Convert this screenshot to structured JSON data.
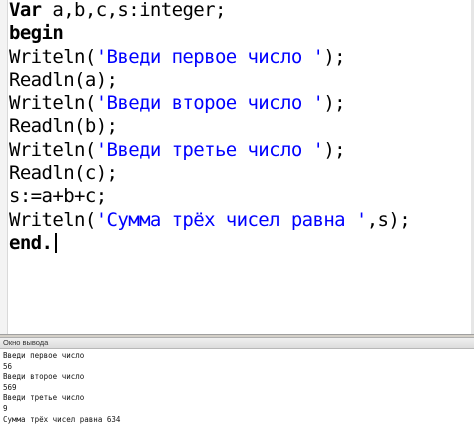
{
  "editor": {
    "lines": [
      {
        "parts": [
          {
            "t": "Var",
            "c": "kw"
          },
          {
            "t": " a,b,c,s:integer;",
            "c": ""
          }
        ]
      },
      {
        "parts": [
          {
            "t": "begin",
            "c": "kw"
          }
        ]
      },
      {
        "parts": [
          {
            "t": "Writeln(",
            "c": ""
          },
          {
            "t": "'Введи первое число '",
            "c": "str"
          },
          {
            "t": ");",
            "c": ""
          }
        ]
      },
      {
        "parts": [
          {
            "t": "Readln(a);",
            "c": ""
          }
        ]
      },
      {
        "parts": [
          {
            "t": "Writeln(",
            "c": ""
          },
          {
            "t": "'Введи второе число '",
            "c": "str"
          },
          {
            "t": ");",
            "c": ""
          }
        ]
      },
      {
        "parts": [
          {
            "t": "Readln(b);",
            "c": ""
          }
        ]
      },
      {
        "parts": [
          {
            "t": "Writeln(",
            "c": ""
          },
          {
            "t": "'Введи третье число '",
            "c": "str"
          },
          {
            "t": ");",
            "c": ""
          }
        ]
      },
      {
        "parts": [
          {
            "t": "Readln(c);",
            "c": ""
          }
        ]
      },
      {
        "parts": [
          {
            "t": "s:=a+b+c;",
            "c": ""
          }
        ]
      },
      {
        "parts": [
          {
            "t": "Writeln(",
            "c": ""
          },
          {
            "t": "'Сумма трёх чисел равна '",
            "c": "str"
          },
          {
            "t": ",s);",
            "c": ""
          }
        ]
      },
      {
        "parts": [
          {
            "t": "end.",
            "c": "kw"
          }
        ],
        "cursor": true
      }
    ]
  },
  "output_panel": {
    "title": "Окно вывода",
    "lines": [
      "Введи первое число",
      "56",
      "Введи второе число",
      "569",
      "Введи третье число",
      "9",
      "Сумма трёх чисел равна 634"
    ]
  },
  "colors": {
    "string": "#0000ff",
    "text": "#000000"
  }
}
